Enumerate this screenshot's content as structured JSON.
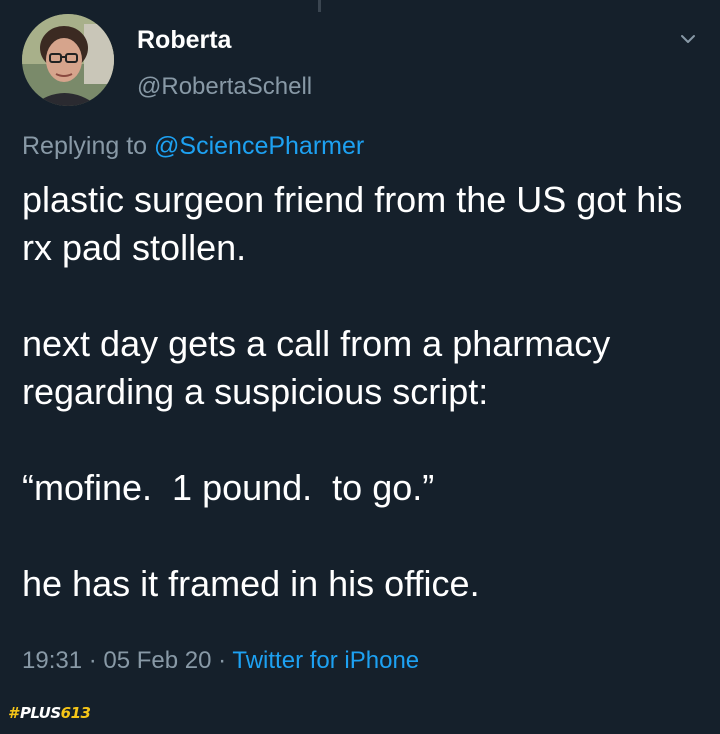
{
  "author": {
    "display_name": "Roberta",
    "handle": "@RobertaSchell"
  },
  "tweet": {
    "reply_prefix": "Replying to ",
    "reply_to": "@SciencePharmer",
    "paragraphs": [
      "plastic surgeon friend from the US got his rx pad stollen.",
      "next day gets a call from a pharmacy regarding a suspicious script:",
      "“mofine.  1 pound.  to go.”",
      "he has it framed in his office."
    ],
    "time": "19:31",
    "separator": " · ",
    "date": "05 Feb 20",
    "source": "Twitter for iPhone"
  },
  "icons": {
    "chevron": "chevron-down-icon",
    "avatar": "user-avatar"
  },
  "watermark": {
    "hash": "#",
    "brand": "PLUS",
    "num": "613"
  },
  "colors": {
    "background": "#15202b",
    "text": "#ffffff",
    "secondary": "#8899a6",
    "link": "#1da1f2",
    "watermark_accent": "#f5c518"
  }
}
